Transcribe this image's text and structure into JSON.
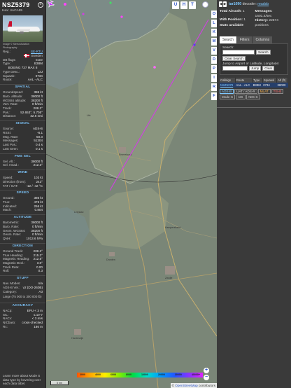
{
  "info": {
    "callsign": "NSZ5379",
    "hex_label": "Hex:",
    "hex": "4ACA95",
    "photo_credit": "Image © Sierra Aviation Photography",
    "registration_label": "Reg.:",
    "registration": "SE-RTU",
    "country": "Sweden",
    "db_flags_label": "DB flags:",
    "db_flags": "none",
    "type_label": "Type:",
    "type": "B38M",
    "type_full": "BOEING 737 MAX 8",
    "type_desc_label": "Type Desc.:",
    "type_desc": "L2J",
    "squawk_label": "Squawk:",
    "squawk": "0734",
    "route_label": "Route:",
    "route": "AAL - ALC",
    "sections": {
      "spatial": "SPATIAL",
      "signal": "SIGNAL",
      "fms": "FMS SEL",
      "wind": "WIND",
      "speed": "SPEED",
      "altitude": "ALTITUDE",
      "direction": "DIRECTION",
      "stuff": "STUFF",
      "accuracy": "ACCURACY"
    },
    "spatial": [
      {
        "k": "Groundspeed:",
        "v": "386 kt"
      },
      {
        "k": "Baro. altitude:",
        "v": "38000 ft"
      },
      {
        "k": "WGS84 altitude:",
        "v": "38200 ft"
      },
      {
        "k": "Vert. Rate:",
        "v": "0 ft/min"
      },
      {
        "k": "Track:",
        "v": "208.2°"
      },
      {
        "k": "Pos.:",
        "v": "52.653°, 5.705°"
      },
      {
        "k": "Distance:",
        "v": "32.6 nmi"
      }
    ],
    "signal": [
      {
        "k": "Source:",
        "v": "ADS-B"
      },
      {
        "k": "RSSI:",
        "v": "-6.1"
      },
      {
        "k": "Msg. Rate:",
        "v": "50.3"
      },
      {
        "k": "Messages:",
        "v": "51304"
      },
      {
        "k": "Last Pos.:",
        "v": "0.4 s"
      },
      {
        "k": "Last Seen:",
        "v": "0.1 s"
      }
    ],
    "fms": [
      {
        "k": "Sel. Alt.:",
        "v": "38000 ft"
      },
      {
        "k": "Sel. Head.:",
        "v": "212.3°"
      }
    ],
    "wind": [
      {
        "k": "Speed:",
        "v": "103 kt"
      },
      {
        "k": "Direction (from):",
        "v": "243°"
      },
      {
        "k": "TAT / OAT:",
        "v": "-12 / -42 °C"
      }
    ],
    "speed": [
      {
        "k": "Ground:",
        "v": "386 kt"
      },
      {
        "k": "True:",
        "v": "476 kt"
      },
      {
        "k": "Indicated:",
        "v": "256 kt"
      },
      {
        "k": "Mach:",
        "v": "0.804"
      }
    ],
    "altitude": [
      {
        "k": "Barometric:",
        "v": "38000 ft"
      },
      {
        "k": "Baro. Rate:",
        "v": "0 ft/min"
      },
      {
        "k": "Geom. WGS84:",
        "v": "38200 ft"
      },
      {
        "k": "Geom. Rate:",
        "v": "0 ft/min"
      },
      {
        "k": "QNH:",
        "v": "1013.6 hPa"
      }
    ],
    "direction": [
      {
        "k": "Ground Track:",
        "v": "208.2°"
      },
      {
        "k": "True Heading:",
        "v": "215.3°"
      },
      {
        "k": "Magnetic Heading:",
        "v": "212.5°"
      },
      {
        "k": "Magnetic Decl.:",
        "v": "3.0°"
      },
      {
        "k": "Track Rate:",
        "v": "0.00"
      },
      {
        "k": "Roll:",
        "v": "0.3"
      }
    ],
    "stuff": [
      {
        "k": "Nav. Modes:",
        "v": "n/a"
      },
      {
        "k": "ADS-B Ver.:",
        "v": "v2 (DO-260B)"
      },
      {
        "k": "Category:",
        "v": "A3"
      }
    ],
    "category_note": "Large (75 000 to 300 000 lb)",
    "accuracy": [
      {
        "k": "NACp:",
        "v": "EPU < 3 m"
      },
      {
        "k": "SIL:",
        "v": "≤ 1e-7"
      },
      {
        "k": "NACv:",
        "v": "< 3 m/s"
      },
      {
        "k": "NICbaro:",
        "v": "cross-checked"
      },
      {
        "k": "Rc:",
        "v": "186 m"
      }
    ],
    "help_text": "Learn more about Mode S data type by hovering over each data label."
  },
  "map": {
    "buttons_top": [
      "U",
      "H",
      "T"
    ],
    "buttons_side": [
      "O",
      "L",
      "K",
      "M",
      "V",
      "D",
      "P",
      "I",
      "R",
      "F"
    ],
    "zoom_in": "+",
    "zoom_out": "−",
    "scale": "5 nm",
    "alt_ticks": [
      "2000",
      "4000",
      "6000",
      "8000",
      "10000",
      "20000",
      "30000",
      "40000+"
    ],
    "attribution_prefix": "© ",
    "attribution_link": "OpenStreetMap",
    "attribution_suffix": " contributors",
    "place_labels": [
      "Emmeloord",
      "Lelystad",
      "Kampereiland",
      "Zwolle",
      "Harderwijk",
      "Dronten",
      "Urk"
    ]
  },
  "sidebar": {
    "decoder_name": "tar1090",
    "decoder_text": " decoder: ",
    "decoder_link": "readsb",
    "total_label": "Total Aircraft:",
    "total": "1",
    "with_pos_label": "With Position:",
    "with_pos": "1",
    "stats_label": "Stats available",
    "messages_label": "Messages:",
    "messages": "1601.4/sec",
    "history_label": "History:",
    "history": "22574 positions",
    "tabs": [
      "Search",
      "Filters",
      "Columns"
    ],
    "search_label": "Search:",
    "search_button": "Search",
    "clear_search": "Clear Search",
    "jump_label": "Jump to Airport or Latitude, Longitude:",
    "jump_button": "Jump",
    "clear_button": "Clear",
    "table_headers": [
      "Callsign",
      "Route",
      "Type",
      "Squawk",
      "Alt (ft)"
    ],
    "table_row": [
      "NSZ5379",
      "AAL - ALC",
      "B38M",
      "0734",
      "38000"
    ],
    "pills": [
      "ADS-B",
      "UAT / ADS-R",
      "MLAT",
      "TIS-B",
      "Mode-S",
      "AIS",
      "ADS-C"
    ]
  }
}
